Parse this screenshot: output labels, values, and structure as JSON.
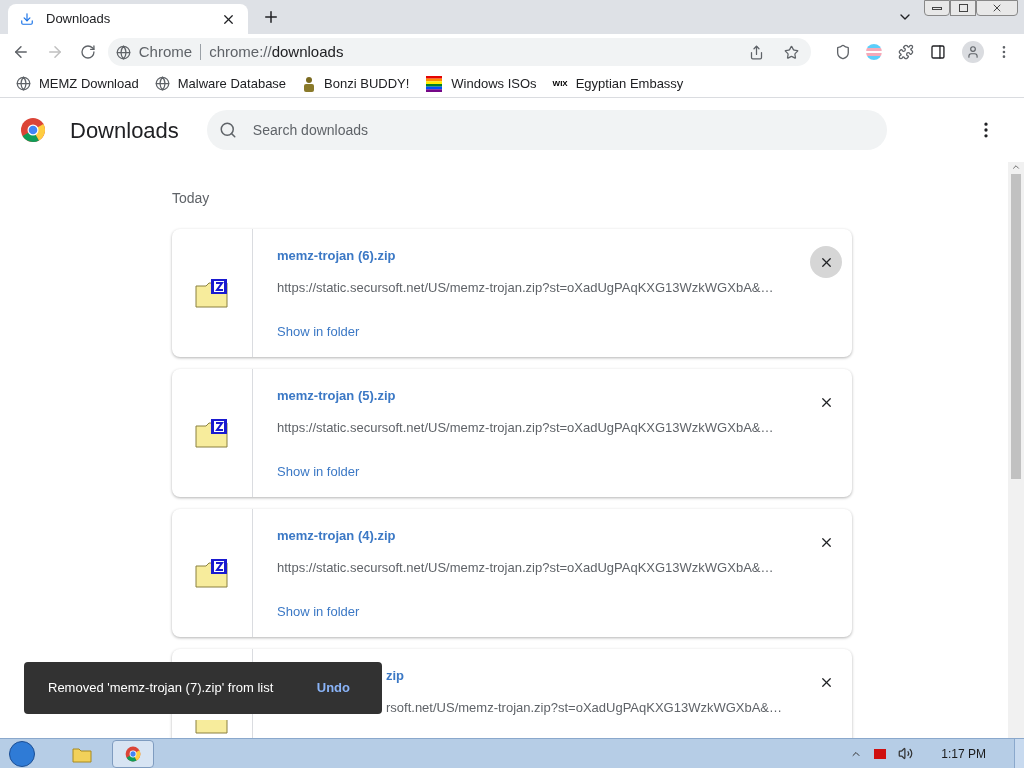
{
  "tab": {
    "title": "Downloads",
    "selected": true
  },
  "address_bar": {
    "site_label": "Chrome",
    "url_prefix": "chrome://",
    "url_host": "downloads"
  },
  "bookmarks": [
    {
      "label": "MEMZ Download",
      "kind": "globe"
    },
    {
      "label": "Malware Database",
      "kind": "globe"
    },
    {
      "label": "Bonzi BUDDY!",
      "kind": "figure"
    },
    {
      "label": "Windows ISOs",
      "kind": "rainbow"
    },
    {
      "label": "Egyptian Embassy",
      "kind": "wix",
      "icon_text": "WIX"
    }
  ],
  "page": {
    "title": "Downloads",
    "search": {
      "placeholder": "Search downloads"
    },
    "section": "Today"
  },
  "downloads": [
    {
      "name": "memz-trojan (6).zip",
      "url": "https://static.secursoft.net/US/memz-trojan.zip?st=oXadUgPAqKXG13WzkWGXbA&…",
      "action": "Show in folder",
      "hovered": true,
      "covered": false
    },
    {
      "name": "memz-trojan (5).zip",
      "url": "https://static.secursoft.net/US/memz-trojan.zip?st=oXadUgPAqKXG13WzkWGXbA&…",
      "action": "Show in folder",
      "hovered": false,
      "covered": false
    },
    {
      "name": "memz-trojan (4).zip",
      "url": "https://static.secursoft.net/US/memz-trojan.zip?st=oXadUgPAqKXG13WzkWGXbA&…",
      "action": "Show in folder",
      "hovered": false,
      "covered": false
    },
    {
      "name": "zip",
      "url": "rsoft.net/US/memz-trojan.zip?st=oXadUgPAqKXG13WzkWGXbA&…",
      "hovered": false,
      "covered": true
    }
  ],
  "toast": {
    "message": "Removed 'memz-trojan (7).zip' from list",
    "action": "Undo"
  },
  "taskbar": {
    "clock": "1:17 PM"
  }
}
